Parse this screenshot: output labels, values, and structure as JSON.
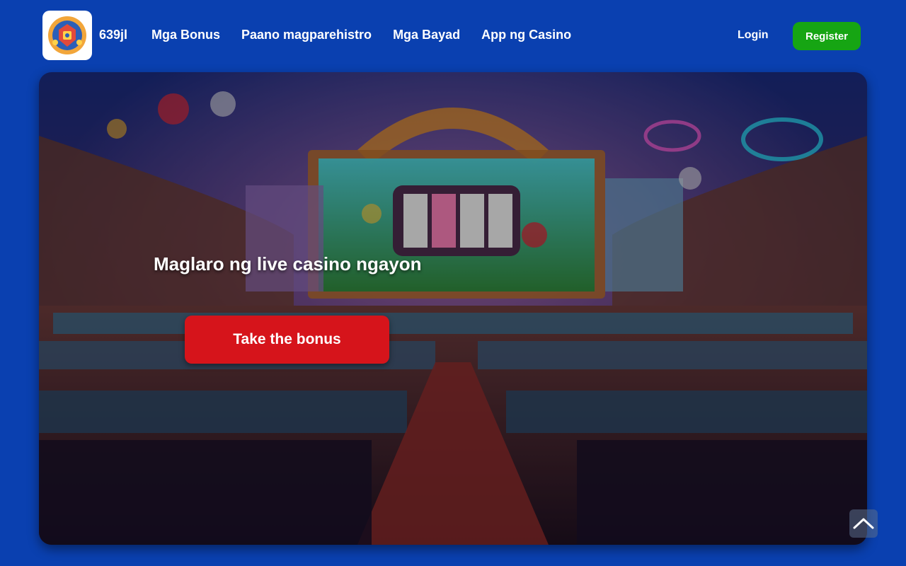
{
  "header": {
    "brand": "639jl",
    "logo_icon": "casino-crest-logo",
    "nav": [
      {
        "label": "Mga Bonus"
      },
      {
        "label": "Paano magparehistro"
      },
      {
        "label": "Mga Bayad"
      },
      {
        "label": "App ng Casino"
      }
    ],
    "login_label": "Login",
    "register_label": "Register"
  },
  "hero": {
    "title": "Maglaro ng live casino ngayon",
    "cta_label": "Take the bonus",
    "background_icon": "casino-hall-illustration"
  },
  "scroll_top_icon": "chevron-up-icon",
  "colors": {
    "page_background": "#0a40b0",
    "register_button": "#16a513",
    "cta_button": "#d6141b"
  }
}
